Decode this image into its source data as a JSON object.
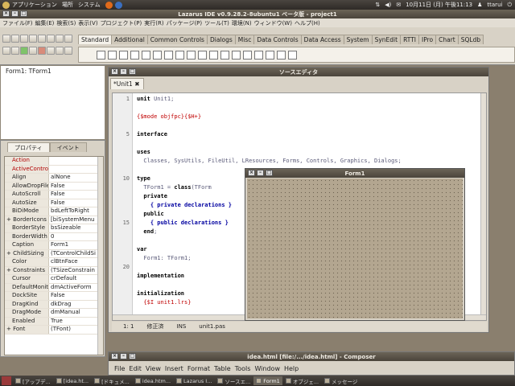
{
  "top_panel": {
    "menus": [
      "アプリケーション",
      "場所",
      "システム"
    ],
    "clock": "10月11日 (月) 午後11:13",
    "user": "ttarui"
  },
  "ide": {
    "title": "Lazarus IDE v0.9.28.2-8ubuntu1 ベータ版 - project1",
    "menu": [
      "ファイル(F)",
      "編集(E)",
      "検索(S)",
      "表示(V)",
      "プロジェクト(P)",
      "実行(R)",
      "パッケージ(P)",
      "ツール(T)",
      "環境(N)",
      "ウィンドウ(W)",
      "ヘルプ(H)"
    ],
    "palette_tabs": [
      "Standard",
      "Additional",
      "Common Controls",
      "Dialogs",
      "Misc",
      "Data Controls",
      "Data Access",
      "System",
      "SynEdit",
      "RTTI",
      "IPro",
      "Chart",
      "SQLdb"
    ],
    "active_palette_tab": "Standard"
  },
  "object_tree": {
    "root": "Form1: TForm1"
  },
  "inspector": {
    "tabs": [
      "プロパティ",
      "イベント"
    ],
    "rows": [
      {
        "name": "Action",
        "value": "",
        "event": true
      },
      {
        "name": "ActiveControl",
        "value": "",
        "event": true
      },
      {
        "name": "Align",
        "value": "alNone"
      },
      {
        "name": "AllowDropFiles",
        "value": "False"
      },
      {
        "name": "AutoScroll",
        "value": "False"
      },
      {
        "name": "AutoSize",
        "value": "False"
      },
      {
        "name": "BiDiMode",
        "value": "bdLeftToRight"
      },
      {
        "name": "BorderIcons",
        "value": "[biSystemMenu",
        "expand": true
      },
      {
        "name": "BorderStyle",
        "value": "bsSizeable"
      },
      {
        "name": "BorderWidth",
        "value": "0"
      },
      {
        "name": "Caption",
        "value": "Form1"
      },
      {
        "name": "ChildSizing",
        "value": "(TControlChildSi",
        "expand": true
      },
      {
        "name": "Color",
        "value": "clBtnFace"
      },
      {
        "name": "Constraints",
        "value": "(TSizeConstrain",
        "expand": true
      },
      {
        "name": "Cursor",
        "value": "crDefault"
      },
      {
        "name": "DefaultMonitor",
        "value": "dmActiveForm"
      },
      {
        "name": "DockSite",
        "value": "False"
      },
      {
        "name": "DragKind",
        "value": "dkDrag"
      },
      {
        "name": "DragMode",
        "value": "dmManual"
      },
      {
        "name": "Enabled",
        "value": "True"
      },
      {
        "name": "Font",
        "value": "(TFont)",
        "expand": true
      }
    ]
  },
  "source_editor": {
    "title": "ソースエディタ",
    "tab": "*Unit1",
    "line_numbers": [
      "1",
      "5",
      "10",
      "15",
      "20"
    ],
    "lines": [
      [
        {
          "t": "unit ",
          "c": "kw"
        },
        {
          "t": "Unit1;",
          "c": "plain"
        }
      ],
      [],
      [
        {
          "t": "{$mode objfpc}{$H+}",
          "c": "dir"
        }
      ],
      [],
      [
        {
          "t": "interface",
          "c": "kw"
        }
      ],
      [],
      [
        {
          "t": "uses",
          "c": "kw"
        }
      ],
      [
        {
          "t": "  Classes, SysUtils, FileUtil, LResources, Forms, Controls, Graphics, Dialogs;",
          "c": "plain"
        }
      ],
      [],
      [
        {
          "t": "type",
          "c": "kw"
        }
      ],
      [
        {
          "t": "  TForm1 = ",
          "c": "plain"
        },
        {
          "t": "class",
          "c": "kw"
        },
        {
          "t": "(TForm",
          "c": "plain"
        }
      ],
      [
        {
          "t": "  private",
          "c": "kw"
        }
      ],
      [
        {
          "t": "    { private declarations }",
          "c": "cm"
        }
      ],
      [
        {
          "t": "  public",
          "c": "kw"
        }
      ],
      [
        {
          "t": "    { public declarations }",
          "c": "cm"
        }
      ],
      [
        {
          "t": "  end",
          "c": "kw"
        },
        {
          "t": ";",
          "c": "plain"
        }
      ],
      [],
      [
        {
          "t": "var",
          "c": "kw"
        }
      ],
      [
        {
          "t": "  Form1: TForm1;",
          "c": "plain"
        }
      ],
      [],
      [
        {
          "t": "implementation",
          "c": "kw"
        }
      ],
      [],
      [
        {
          "t": "initialization",
          "c": "kw"
        }
      ],
      [
        {
          "t": "  {$I unit1.lrs}",
          "c": "dir"
        }
      ]
    ],
    "status": {
      "line": "1:",
      "col": "1",
      "modified": "修正済",
      "mode": "INS",
      "file": "unit1.pas"
    }
  },
  "form_designer": {
    "title": "Form1"
  },
  "composer": {
    "title": "idea.html [file:/.../idea.html] - Composer",
    "menu": [
      "File",
      "Edit",
      "View",
      "Insert",
      "Format",
      "Table",
      "Tools",
      "Window",
      "Help"
    ]
  },
  "taskbar": {
    "items": [
      {
        "label": "[アップデ...",
        "active": false
      },
      {
        "label": "[idea.ht...",
        "active": false
      },
      {
        "label": "[ドキュメ...",
        "active": false
      },
      {
        "label": "idea.htm...",
        "active": false
      },
      {
        "label": "Lazarus I...",
        "active": false
      },
      {
        "label": "ソースエ...",
        "active": false
      },
      {
        "label": "Form1",
        "active": true
      },
      {
        "label": "オブジェ...",
        "active": false
      },
      {
        "label": "メッセージ",
        "active": false
      }
    ]
  },
  "colors": {
    "panel": "#2e2a26",
    "window_bg": "#d8d2c6",
    "form_grid": "#b3a690",
    "keyword": "#000000",
    "directive": "#c00000",
    "comment": "#0000a0"
  }
}
